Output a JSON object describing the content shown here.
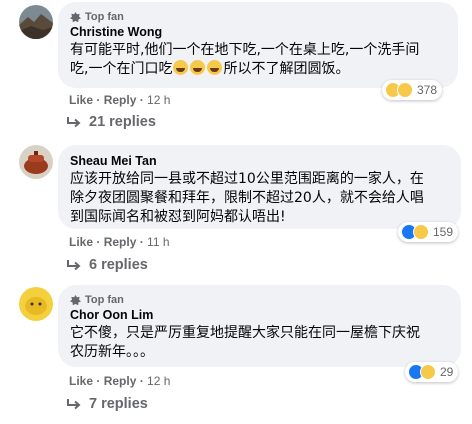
{
  "comments": [
    {
      "badge": "Top fan",
      "author": "Christine Wong",
      "text_line1": "有可能平时,他们一个在地下吃,一个在桌上吃,一个洗手间",
      "text_line2_pre": "吃,一个在门口吃",
      "text_line2_post": "所以不了解团圆饭。",
      "reaction_count": "378",
      "like_label": "Like",
      "reply_label": "Reply",
      "time": "12 h",
      "replies_label": "21 replies"
    },
    {
      "author": "Sheau Mei Tan",
      "text_line1": "应该开放给同一县或不超过10公里范围距离的一家人，在",
      "text_line2": "除夕夜团圆聚餐和拜年，限制不超过20人，就不会给人唱",
      "text_line3": "到国际闻名和被怼到阿妈都认唔出!",
      "reaction_count": "159",
      "like_label": "Like",
      "reply_label": "Reply",
      "time": "11 h",
      "replies_label": "6 replies"
    },
    {
      "badge": "Top fan",
      "author": "Chor Oon Lim",
      "text_line1": "它不傻，只是严厉重复地提醒大家只能在同一屋檐下庆祝",
      "text_line2": "农历新年。。。",
      "reaction_count": "29",
      "like_label": "Like",
      "reply_label": "Reply",
      "time": "12 h",
      "replies_label": "7 replies"
    }
  ],
  "colors": {
    "bubble": "#f0f2f5",
    "meta_text": "#65676b",
    "like_blue": "#1877f2",
    "emoji_yellow": "#f7c94b"
  }
}
